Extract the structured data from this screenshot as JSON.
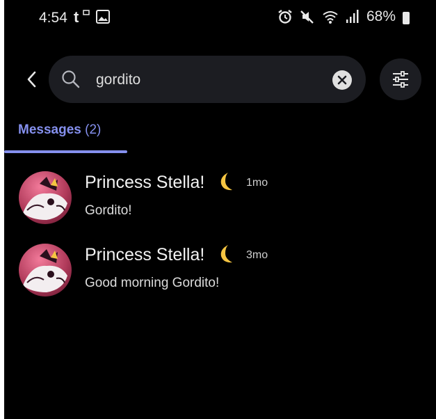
{
  "status_bar": {
    "time": "4:54",
    "battery": "68%",
    "left_icons": [
      "tumblr-icon",
      "image-icon"
    ],
    "right_icons": [
      "alarm-icon",
      "mute-icon",
      "wifi-icon",
      "signal-icon",
      "battery-icon"
    ]
  },
  "search": {
    "query": "gordito",
    "icons": [
      "back-arrow-icon",
      "search-icon",
      "clear-icon",
      "filter-icon"
    ]
  },
  "tabs": [
    {
      "label": "Messages",
      "count": "(2)",
      "active": true
    }
  ],
  "results": [
    {
      "author": "Princess Stella!",
      "emoji": "crescent-moon-icon",
      "timestamp": "1mo",
      "text": "Gordito!"
    },
    {
      "author": "Princess Stella!",
      "emoji": "crescent-moon-icon",
      "timestamp": "3mo",
      "text": "Good morning Gordito!"
    }
  ],
  "colors": {
    "background": "#000000",
    "accent": "#8590ee",
    "search_box": "#1c1d22",
    "moon": "#f5c542"
  }
}
